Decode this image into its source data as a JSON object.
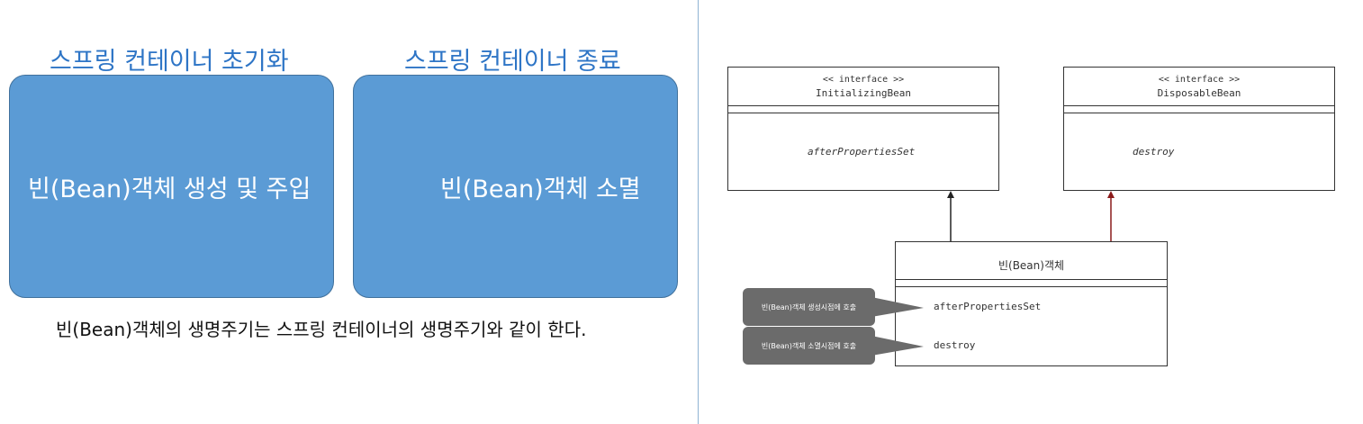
{
  "left_panel": {
    "init_heading": "스프링 컨테이너 초기화",
    "destroy_heading": "스프링 컨테이너 종료",
    "init_box_text": "빈(Bean)객체 생성 및 주입",
    "destroy_box_text": "빈(Bean)객체 소멸",
    "caption": "빈(Bean)객체의 생명주기는 스프링 컨테이너의 생명주기와 같이 한다.",
    "box_color": "#5b9bd5",
    "heading_color": "#2e75c6"
  },
  "uml": {
    "initializing": {
      "stereotype": "<< interface >>",
      "name": "InitializingBean",
      "operation": "afterPropertiesSet"
    },
    "disposable": {
      "stereotype": "<< interface >>",
      "name": "DisposableBean",
      "operation": "destroy"
    },
    "bean": {
      "name": "빈(Bean)객체",
      "op1": "afterPropertiesSet",
      "op2": "destroy"
    },
    "notes": {
      "create": "빈(Bean)객체 생성시점에 호출",
      "destroy": "빈(Bean)객체 소멸시점에 호출"
    },
    "arrow_colors": {
      "initializing": "#222222",
      "disposable": "#8b1a1a"
    },
    "note_color": "#6b6b6b"
  }
}
